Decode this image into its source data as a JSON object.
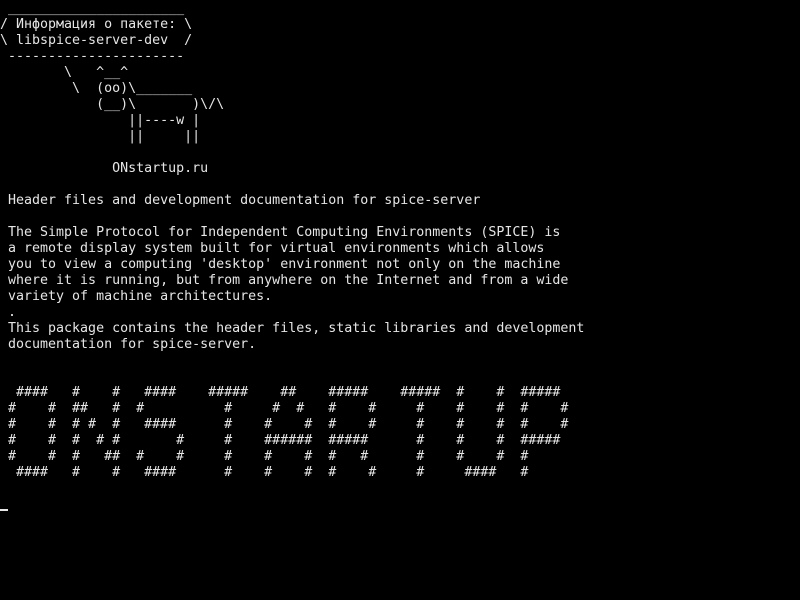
{
  "cowsay": {
    "top_border": " ______________________",
    "bubble_line_1": "/ Информация о пакете: \\",
    "bubble_line_2": "\\ libspice-server-dev  /",
    "bottom_border": " ----------------------",
    "cow_line_1": "        \\   ^__^",
    "cow_line_2": "         \\  (oo)\\_______",
    "cow_line_3": "            (__)\\       )\\/\\",
    "cow_line_4": "                ||----w |",
    "cow_line_5": "                ||     ||",
    "site": "              ONstartup.ru"
  },
  "package": {
    "summary": " Header files and development documentation for spice-server",
    "desc_1": " The Simple Protocol for Independent Computing Environments (SPICE) is",
    "desc_2": " a remote display system built for virtual environments which allows",
    "desc_3": " you to view a computing 'desktop' environment not only on the machine",
    "desc_4": " where it is running, but from anywhere on the Internet and from a wide",
    "desc_5": " variety of machine architectures.",
    "desc_6": " .",
    "desc_7": " This package contains the header files, static libraries and development",
    "desc_8": " documentation for spice-server."
  },
  "banner": {
    "row_1": "  ####   #    #   ####    #####    ##    #####    #####  #    #  #####",
    "row_2": " #    #  ##   #  #          #     #  #   #    #     #    #    #  #    #",
    "row_3": " #    #  # #  #   ####      #    #    #  #    #     #    #    #  #    #",
    "row_4": " #    #  #  # #       #     #    ######  #####      #    #    #  #####",
    "row_5": " #    #  #   ##  #    #     #    #    #  #   #      #    #    #  #",
    "row_6": "  ####   #    #   ####      #    #    #  #    #     #     ####   #"
  }
}
